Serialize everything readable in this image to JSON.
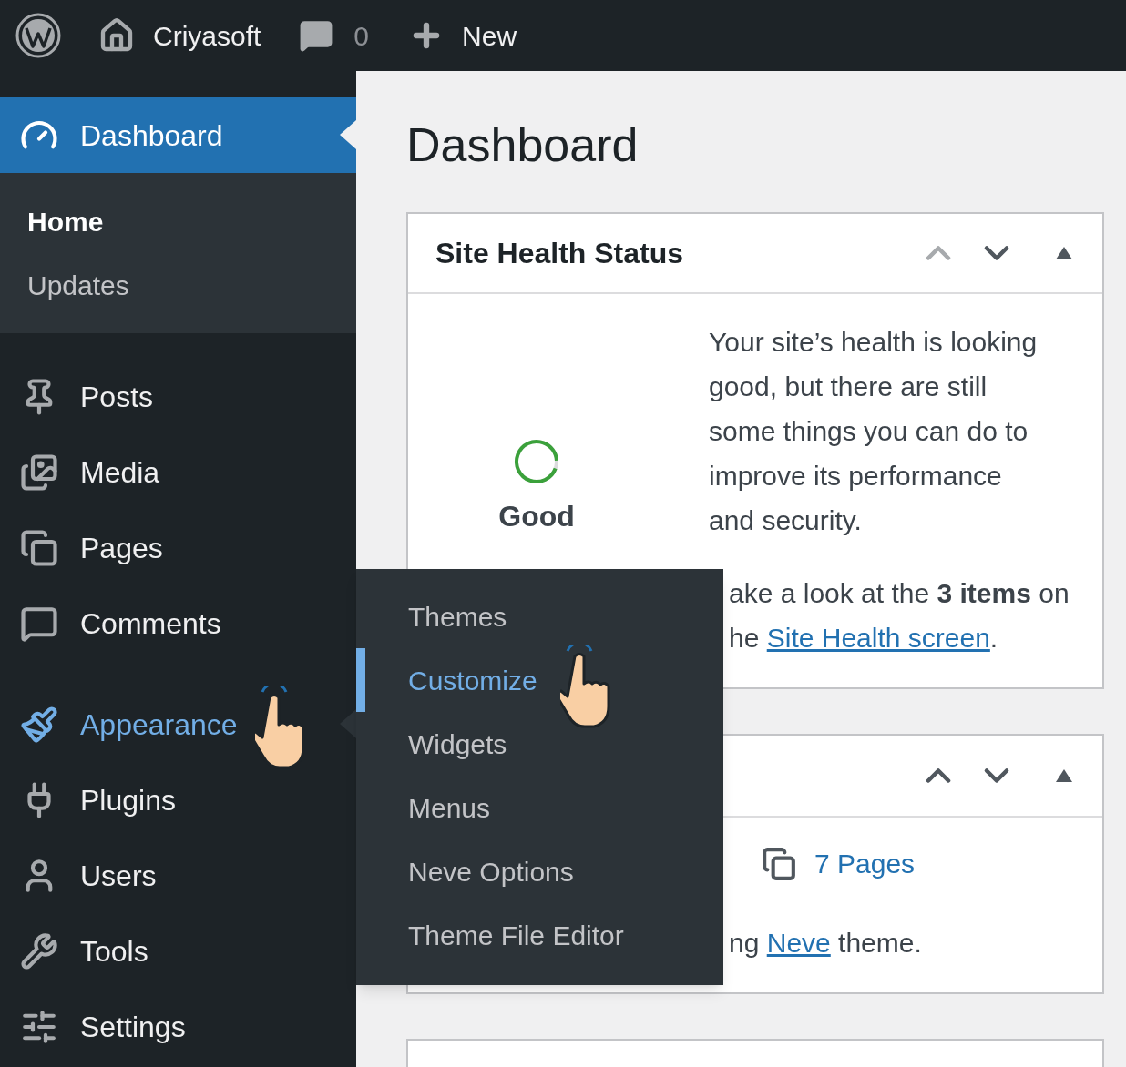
{
  "top_bar": {
    "site_name": "Criyasoft",
    "comments_count": "0",
    "new_label": "New"
  },
  "sidebar": {
    "groups": [
      {
        "items": [
          {
            "label": "Dashboard",
            "selected": true,
            "hovered": false,
            "children": [
              {
                "label": "Home",
                "selected": true
              },
              {
                "label": "Updates",
                "selected": false
              }
            ]
          }
        ]
      },
      {
        "items": [
          {
            "label": "Posts",
            "selected": false,
            "hovered": false
          },
          {
            "label": "Media",
            "selected": false,
            "hovered": false
          },
          {
            "label": "Pages",
            "selected": false,
            "hovered": false
          },
          {
            "label": "Comments",
            "selected": false,
            "hovered": false
          }
        ]
      },
      {
        "items": [
          {
            "label": "Appearance",
            "selected": false,
            "hovered": true
          },
          {
            "label": "Plugins",
            "selected": false,
            "hovered": false
          },
          {
            "label": "Users",
            "selected": false,
            "hovered": false
          },
          {
            "label": "Tools",
            "selected": false,
            "hovered": false
          },
          {
            "label": "Settings",
            "selected": false,
            "hovered": false
          }
        ]
      }
    ]
  },
  "flyout": {
    "items": [
      {
        "label": "Themes",
        "selected": false
      },
      {
        "label": "Customize",
        "selected": true
      },
      {
        "label": "Widgets",
        "selected": false
      },
      {
        "label": "Menus",
        "selected": false
      },
      {
        "label": "Neve Options",
        "selected": false
      },
      {
        "label": "Theme File Editor",
        "selected": false
      }
    ]
  },
  "page": {
    "title": "Dashboard",
    "cards": [
      {
        "kind": "health",
        "title": "Site Health Status",
        "move_up_disabled": true,
        "status": "Good",
        "level": 0.93,
        "text": "Your site’s health is looking good, but there are still some things you can do to improve its performance and security.",
        "note_line_1": "ake a look at the **3 items** on",
        "note_prefix": "he ",
        "note_link": "Site Health screen",
        "note_suffix": "."
      },
      {
        "kind": "glance",
        "move_up_disabled": false,
        "pages": "7 Pages",
        "footer_prefix": "ng ",
        "footer_link": "Neve",
        "footer_suffix": " theme."
      },
      {
        "kind": "blank"
      }
    ]
  }
}
